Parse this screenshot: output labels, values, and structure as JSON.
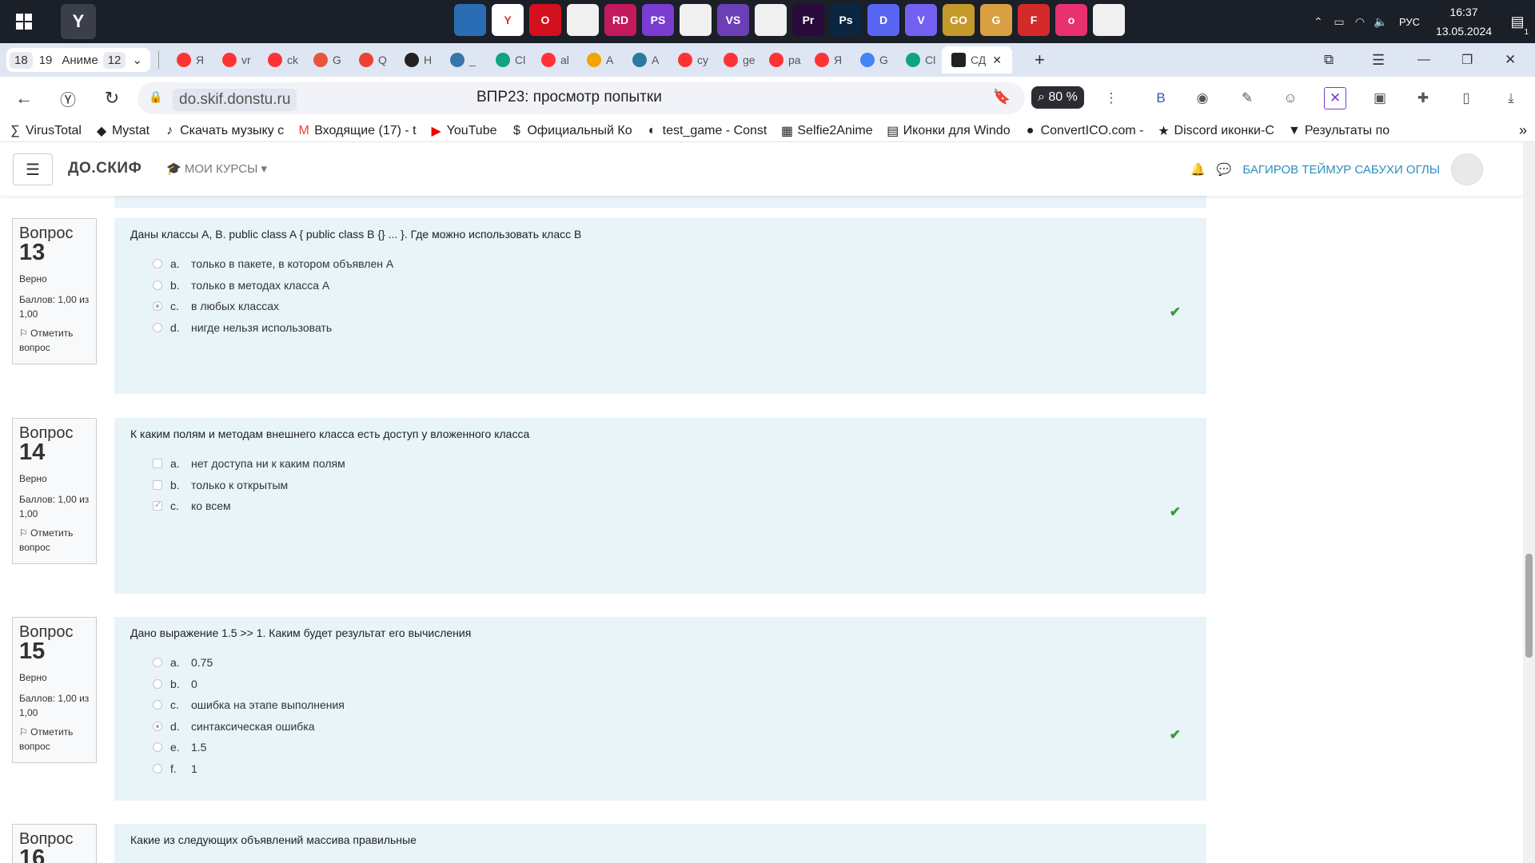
{
  "taskbar": {
    "apps": [
      {
        "icon": "remote-desktop-icon",
        "label": "",
        "color": "#2a6db5"
      },
      {
        "icon": "yandex-browser-icon",
        "label": "Y",
        "color": "#ffffff"
      },
      {
        "icon": "opera-icon",
        "label": "O",
        "color": "#d3101d"
      },
      {
        "icon": "file-icon",
        "label": "",
        "color": "#f0f0f0"
      },
      {
        "icon": "rider-icon",
        "label": "RD",
        "color": "#c21a5d"
      },
      {
        "icon": "phpstorm-icon",
        "label": "PS",
        "color": "#7b3cd1"
      },
      {
        "icon": "file-icon",
        "label": "",
        "color": "#f0f0f0"
      },
      {
        "icon": "visual-studio-icon",
        "label": "VS",
        "color": "#6c3fb6"
      },
      {
        "icon": "file-icon",
        "label": "",
        "color": "#f0f0f0"
      },
      {
        "icon": "premiere-icon",
        "label": "Pr",
        "color": "#2a0a3a"
      },
      {
        "icon": "photoshop-icon",
        "label": "Ps",
        "color": "#0a2640"
      },
      {
        "icon": "discord-icon",
        "label": "D",
        "color": "#5865f2"
      },
      {
        "icon": "viber-icon",
        "label": "V",
        "color": "#7360f2"
      },
      {
        "icon": "csgo-icon",
        "label": "GO",
        "color": "#c49a2a"
      },
      {
        "icon": "game-icon",
        "label": "G",
        "color": "#d8a040"
      },
      {
        "icon": "forza-icon",
        "label": "F",
        "color": "#d42a2a"
      },
      {
        "icon": "osu-icon",
        "label": "o",
        "color": "#e8316e"
      },
      {
        "icon": "file-icon",
        "label": "",
        "color": "#f0f0f0"
      }
    ],
    "lang": "РУС",
    "time": "16:37",
    "date": "13.05.2024",
    "notifications": "1"
  },
  "tabs": {
    "workspace_count": "18",
    "workspace_name": "19",
    "workspace_label": "Аниме",
    "workspace_tabs": "12",
    "items": [
      {
        "icon": "yandex-icon",
        "label": "Я",
        "color": "#f33"
      },
      {
        "icon": "yandex-icon",
        "label": "vr",
        "color": "#f33"
      },
      {
        "icon": "yandex-icon",
        "label": "ck",
        "color": "#f33"
      },
      {
        "icon": "git-icon",
        "label": "G",
        "color": "#e8543a"
      },
      {
        "icon": "gmail-icon",
        "label": "Q",
        "color": "#ea4335"
      },
      {
        "icon": "github-icon",
        "label": "H",
        "color": "#222"
      },
      {
        "icon": "python-icon",
        "label": "_",
        "color": "#3776ab"
      },
      {
        "icon": "chatgpt-icon",
        "label": "Cl",
        "color": "#10a37f"
      },
      {
        "icon": "yandex-icon",
        "label": "al",
        "color": "#f33"
      },
      {
        "icon": "academy-icon",
        "label": "A",
        "color": "#f0a500"
      },
      {
        "icon": "ai-icon",
        "label": "A",
        "color": "#2c7a9e"
      },
      {
        "icon": "yandex-icon",
        "label": "cy",
        "color": "#f33"
      },
      {
        "icon": "yandex-icon",
        "label": "ge",
        "color": "#f33"
      },
      {
        "icon": "yandex-icon",
        "label": "pa",
        "color": "#f33"
      },
      {
        "icon": "yandex-icon",
        "label": "Я",
        "color": "#f33"
      },
      {
        "icon": "gemini-icon",
        "label": "G",
        "color": "#4285f4"
      },
      {
        "icon": "chatgpt-icon",
        "label": "Cl",
        "color": "#10a37f"
      }
    ],
    "active": {
      "icon": "skif-icon",
      "label": "СД",
      "color": "#222"
    }
  },
  "omnibox": {
    "domain": "do.skif.donstu.ru",
    "page_title": "ВПР23: просмотр попытки",
    "zoom": "80 %"
  },
  "bookmarks": [
    {
      "icon": "virustotal-icon",
      "label": "VirusTotal"
    },
    {
      "icon": "mystat-icon",
      "label": "Mystat"
    },
    {
      "icon": "music-icon",
      "label": "Скачать музыку с"
    },
    {
      "icon": "gmail-icon",
      "label": "Входящие (17) - t"
    },
    {
      "icon": "youtube-icon",
      "label": "YouTube"
    },
    {
      "icon": "dollar-icon",
      "label": "Официальный Ко"
    },
    {
      "icon": "game-icon",
      "label": "test_game - Const"
    },
    {
      "icon": "selfie-icon",
      "label": "Selfie2Anime"
    },
    {
      "icon": "icons-icon",
      "label": "Иконки для Windo"
    },
    {
      "icon": "convert-icon",
      "label": "ConvertICO.com -"
    },
    {
      "icon": "discord-icon",
      "label": "Discord иконки-С"
    },
    {
      "icon": "results-icon",
      "label": "Результаты по"
    }
  ],
  "moodle": {
    "brand": "ДО.СКИФ",
    "my_courses": "МОИ КУРСЫ",
    "user_name": "БАГИРОВ ТЕЙМУР САБУХИ ОГЛЫ"
  },
  "questions": [
    {
      "label": "Вопрос",
      "number": "13",
      "status": "Верно",
      "grade": "Баллов: 1,00 из 1,00",
      "flag": "Отметить вопрос",
      "text": "Даны классы A, B. public class A { public class B {} ... }. Где можно использовать класс B",
      "type": "radio",
      "answers": [
        {
          "letter": "a.",
          "text": "только в пакете, в котором объявлен A",
          "selected": false
        },
        {
          "letter": "b.",
          "text": "только в методах класса A",
          "selected": false
        },
        {
          "letter": "c.",
          "text": "в любых классах",
          "selected": true
        },
        {
          "letter": "d.",
          "text": "нигде нельзя использовать",
          "selected": false
        }
      ]
    },
    {
      "label": "Вопрос",
      "number": "14",
      "status": "Верно",
      "grade": "Баллов: 1,00 из 1,00",
      "flag": "Отметить вопрос",
      "text": "К каким полям и методам внешнего класса есть доступ у вложенного класса",
      "type": "checkbox",
      "answers": [
        {
          "letter": "a.",
          "text": "нет доступа ни к каким полям",
          "selected": false
        },
        {
          "letter": "b.",
          "text": "только к открытым",
          "selected": false
        },
        {
          "letter": "c.",
          "text": "ко всем",
          "selected": true
        }
      ]
    },
    {
      "label": "Вопрос",
      "number": "15",
      "status": "Верно",
      "grade": "Баллов: 1,00 из 1,00",
      "flag": "Отметить вопрос",
      "text": "Дано выражение 1.5 >> 1. Каким будет результат его вычисления",
      "type": "radio",
      "answers": [
        {
          "letter": "a.",
          "text": "0.75",
          "selected": false
        },
        {
          "letter": "b.",
          "text": "0",
          "selected": false
        },
        {
          "letter": "c.",
          "text": "ошибка на этапе выполнения",
          "selected": false
        },
        {
          "letter": "d.",
          "text": "синтаксическая ошибка",
          "selected": true
        },
        {
          "letter": "e.",
          "text": "1.5",
          "selected": false
        },
        {
          "letter": "f.",
          "text": "1",
          "selected": false
        }
      ]
    },
    {
      "label": "Вопрос",
      "number": "16",
      "text": "Какие из следующих объявлений массива правильные"
    }
  ]
}
